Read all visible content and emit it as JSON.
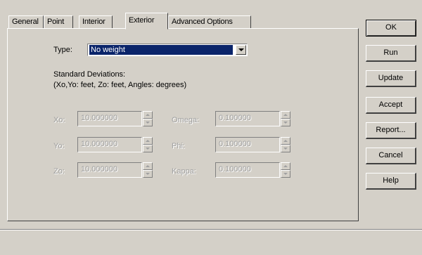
{
  "tabs": [
    {
      "label": "General",
      "active": false
    },
    {
      "label": "Point",
      "active": false
    },
    {
      "label": "Interior",
      "active": false
    },
    {
      "label": "Exterior",
      "active": true
    },
    {
      "label": "Advanced Options",
      "active": false
    }
  ],
  "type": {
    "label": "Type:",
    "selected": "No weight"
  },
  "std_dev": {
    "heading": "Standard Deviations:",
    "units": "(Xo,Yo: feet, Zo: feet, Angles: degrees)"
  },
  "fields": {
    "xo": {
      "label": "Xo:",
      "value": "10.000000"
    },
    "yo": {
      "label": "Yo:",
      "value": "10.000000"
    },
    "zo": {
      "label": "Zo:",
      "value": "10.000000"
    },
    "omega": {
      "label": "Omega:",
      "value": "0.100000"
    },
    "phi": {
      "label": "Phi:",
      "value": "0.100000"
    },
    "kappa": {
      "label": "Kappa:",
      "value": "0.100000"
    }
  },
  "buttons": {
    "ok": "OK",
    "run": "Run",
    "update": "Update",
    "accept": "Accept",
    "report": "Report...",
    "cancel": "Cancel",
    "help": "Help"
  },
  "colors": {
    "selection": "#0a246a",
    "face": "#d4d0c8"
  }
}
